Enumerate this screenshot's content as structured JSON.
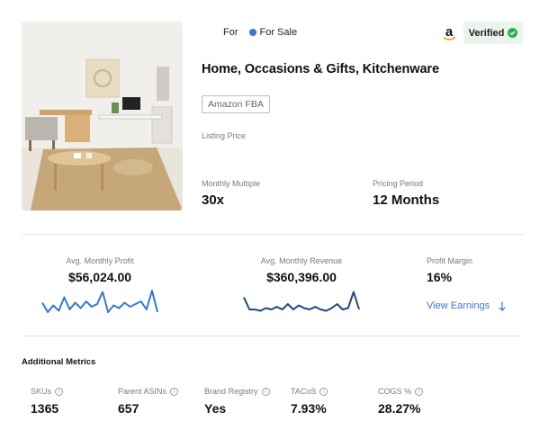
{
  "listing": {
    "for_label": "For",
    "status": "For Sale",
    "status_color": "#3b78c4",
    "marketplace_icon": "amazon-logo",
    "verified_label": "Verified",
    "verified_color": "#2fae4b",
    "title": "Home, Occasions & Gifts, Kitchenware",
    "platform_tag": "Amazon FBA",
    "listing_price_label": "Listing Price",
    "monthly_multiple": {
      "label": "Monthly Multiple",
      "value": "30x"
    },
    "pricing_period": {
      "label": "Pricing Period",
      "value": "12 Months"
    }
  },
  "earnings": {
    "avg_monthly_profit": {
      "label": "Avg. Monthly Profit",
      "value": "$56,024.00"
    },
    "avg_monthly_revenue": {
      "label": "Avg. Monthly Revenue",
      "value": "$360,396.00"
    },
    "profit_margin": {
      "label": "Profit Margin",
      "value": "16%"
    },
    "view_earnings_label": "View Earnings",
    "view_earnings_icon": "arrow-down-icon",
    "profit_spark_color": "#3b78c4",
    "revenue_spark_color": "#1f4a82",
    "profit_trend": [
      0.55,
      0.2,
      0.45,
      0.25,
      0.75,
      0.3,
      0.55,
      0.35,
      0.6,
      0.4,
      0.5,
      0.95,
      0.2,
      0.45,
      0.35,
      0.55,
      0.4,
      0.5,
      0.6,
      0.3,
      1.0,
      0.2
    ],
    "revenue_trend": [
      0.75,
      0.3,
      0.3,
      0.25,
      0.35,
      0.3,
      0.4,
      0.3,
      0.5,
      0.3,
      0.45,
      0.35,
      0.3,
      0.4,
      0.3,
      0.25,
      0.35,
      0.5,
      0.3,
      0.35,
      0.95,
      0.3
    ]
  },
  "additional_metrics": {
    "heading": "Additional Metrics",
    "items": [
      {
        "label": "SKUs",
        "value": "1365"
      },
      {
        "label": "Parent ASINs",
        "value": "657"
      },
      {
        "label": "Brand Registry",
        "value": "Yes"
      },
      {
        "label": "TACoS",
        "value": "7.93%"
      },
      {
        "label": "COGS %",
        "value": "28.27%"
      }
    ]
  }
}
